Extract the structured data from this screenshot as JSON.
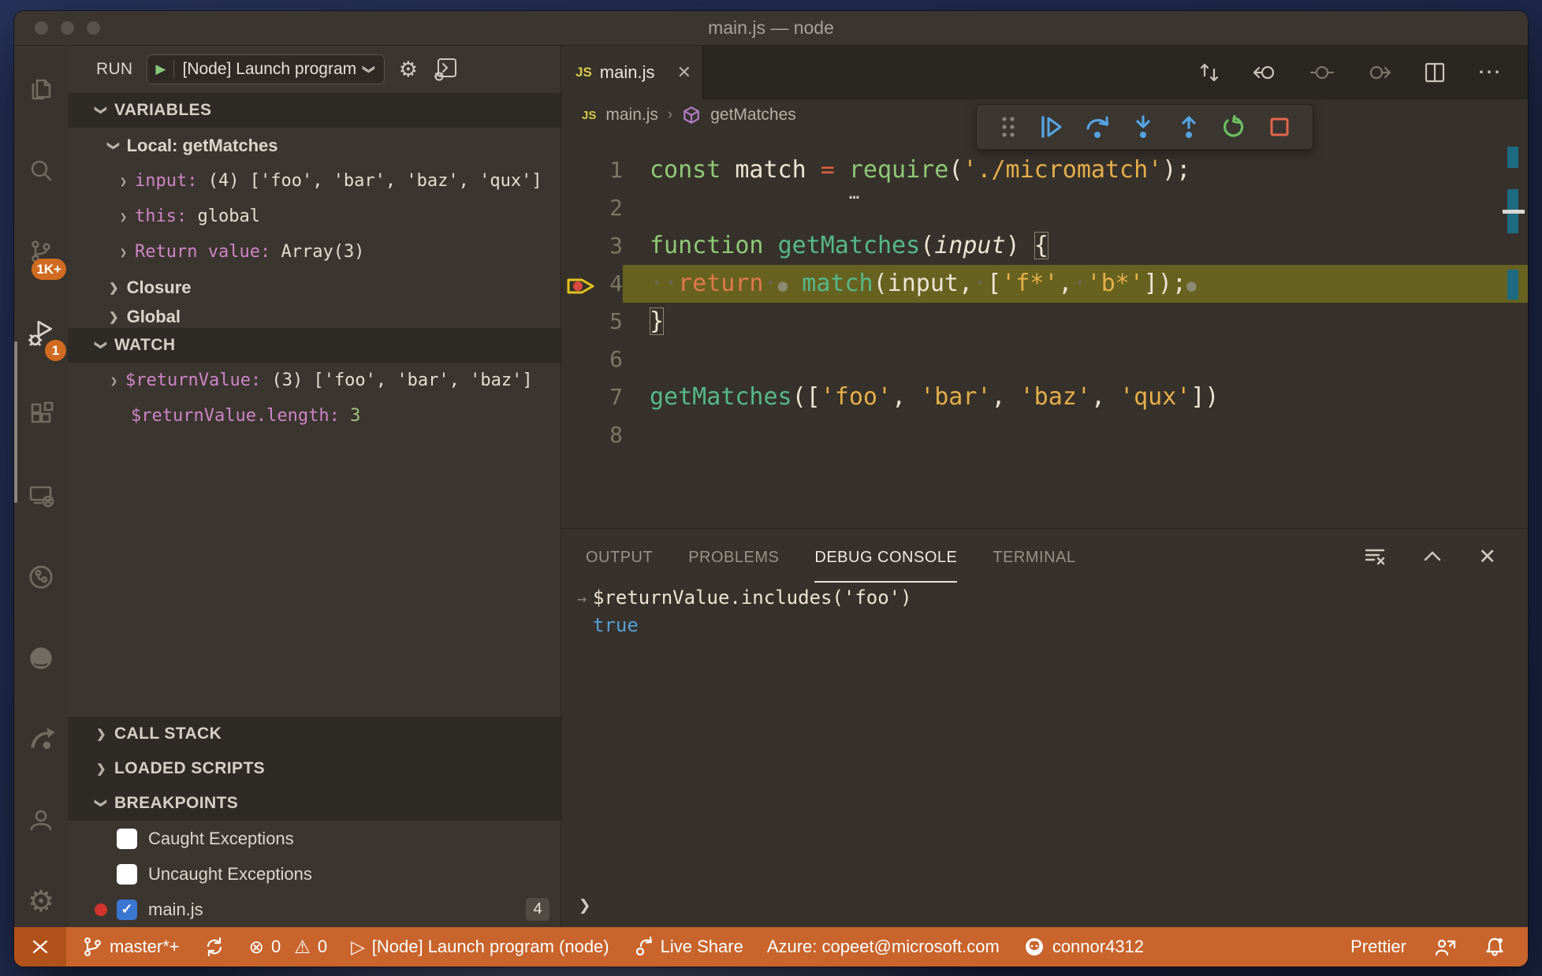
{
  "window": {
    "title": "main.js — node"
  },
  "icons": {
    "chevron": "❯",
    "gear": "⚙",
    "close": "✕",
    "more": "⋯",
    "error": "⊗",
    "warning": "⚠",
    "play_outline": "▷",
    "play_solid": "▶",
    "check": "✓",
    "breadcrumb_sep": "›",
    "console_arrow": "→",
    "prompt": "❯",
    "js_badge": "JS",
    "remote_glyph": "><"
  },
  "activity_bar": {
    "source_control_badge": "1K+",
    "debug_badge": "1"
  },
  "sidebar": {
    "run": {
      "label": "RUN",
      "config": "[Node] Launch program"
    },
    "variables": {
      "header": "VARIABLES",
      "scope": "Local: getMatches",
      "items": [
        {
          "name": "input: ",
          "value": "(4) ['foo', 'bar', 'baz', 'qux']"
        },
        {
          "name": "this: ",
          "value": "global"
        },
        {
          "name": "Return value: ",
          "value": "Array(3)"
        }
      ],
      "groups": [
        "Closure",
        "Global"
      ]
    },
    "watch": {
      "header": "WATCH",
      "item": {
        "name": "$returnValue: ",
        "value": "(3) ['foo', 'bar', 'baz']"
      },
      "plain_item": {
        "name": "$returnValue.length: ",
        "value": "3"
      }
    },
    "sections": [
      "CALL STACK",
      "LOADED SCRIPTS",
      "BREAKPOINTS"
    ],
    "breakpoints": [
      {
        "label": "Caught Exceptions",
        "checked": false
      },
      {
        "label": "Uncaught Exceptions",
        "checked": false
      },
      {
        "label": "main.js",
        "checked": true,
        "badge": "4"
      }
    ]
  },
  "editor": {
    "tab": {
      "label": "main.js"
    },
    "breadcrumb": {
      "file": "main.js",
      "symbol": "getMatches"
    },
    "lines": [
      {
        "num": "1",
        "tokens": [
          {
            "t": "const",
            "c": "kw"
          },
          {
            "t": " match ",
            "c": "txt"
          },
          {
            "t": "=",
            "c": "op"
          },
          {
            "t": " ",
            "c": "txt"
          },
          {
            "t": "require",
            "c": "kw"
          },
          {
            "t": "(",
            "c": "txt"
          },
          {
            "t": "'./micromatch'",
            "c": "str"
          },
          {
            "t": ");",
            "c": "txt"
          }
        ],
        "hint": {
          "text": "…",
          "col": 14
        }
      },
      {
        "num": "2",
        "tokens": []
      },
      {
        "num": "3",
        "tokens": [
          {
            "t": "function",
            "c": "kw"
          },
          {
            "t": " ",
            "c": "txt"
          },
          {
            "t": "getMatches",
            "c": "fn"
          },
          {
            "t": "(",
            "c": "txt"
          },
          {
            "t": "input",
            "c": "it"
          },
          {
            "t": ") ",
            "c": "txt"
          },
          {
            "t": "{",
            "c": "br"
          }
        ]
      },
      {
        "num": "4",
        "hl": true,
        "arrow": true,
        "tokens": [
          {
            "t": "··",
            "c": "ws"
          },
          {
            "t": "return",
            "c": "ret"
          },
          {
            "t": "·",
            "c": "ws"
          },
          {
            "t": "●",
            "c": "bp"
          },
          {
            "t": " ",
            "c": "txt"
          },
          {
            "t": "match",
            "c": "fn"
          },
          {
            "t": "(input,",
            "c": "txt"
          },
          {
            "t": "·",
            "c": "ws"
          },
          {
            "t": "[",
            "c": "txt"
          },
          {
            "t": "'f*'",
            "c": "str"
          },
          {
            "t": ",",
            "c": "txt"
          },
          {
            "t": "·",
            "c": "ws"
          },
          {
            "t": "'b*'",
            "c": "str"
          },
          {
            "t": "]);",
            "c": "txt"
          },
          {
            "t": "●",
            "c": "bp"
          }
        ]
      },
      {
        "num": "5",
        "tokens": [
          {
            "t": "}",
            "c": "br"
          }
        ]
      },
      {
        "num": "6",
        "tokens": []
      },
      {
        "num": "7",
        "tokens": [
          {
            "t": "getMatches",
            "c": "fn"
          },
          {
            "t": "([",
            "c": "txt"
          },
          {
            "t": "'foo'",
            "c": "str"
          },
          {
            "t": ", ",
            "c": "txt"
          },
          {
            "t": "'bar'",
            "c": "str"
          },
          {
            "t": ", ",
            "c": "txt"
          },
          {
            "t": "'baz'",
            "c": "str"
          },
          {
            "t": ", ",
            "c": "txt"
          },
          {
            "t": "'qux'",
            "c": "str"
          },
          {
            "t": "])",
            "c": "txt"
          }
        ]
      },
      {
        "num": "8",
        "tokens": []
      }
    ]
  },
  "panel": {
    "tabs": [
      {
        "label": "OUTPUT"
      },
      {
        "label": "PROBLEMS"
      },
      {
        "label": "DEBUG CONSOLE",
        "active": true
      },
      {
        "label": "TERMINAL"
      }
    ],
    "console": {
      "expression": "$returnValue.includes('foo')",
      "result": "true"
    }
  },
  "status_bar": {
    "branch": "master*+",
    "errors": "0",
    "warnings": "0",
    "run_status": "[Node] Launch program (node)",
    "live_share": "Live Share",
    "azure": "Azure: copeet@microsoft.com",
    "github_user": "connor4312",
    "prettier": "Prettier"
  },
  "colors": {
    "status-bar": "#c8642c",
    "status-cell": "#b2521b",
    "badge": "#d06b21",
    "hl-line": "#67621f",
    "kw": "#8fc978",
    "fn": "#55b98a",
    "str": "#e5ae4a",
    "op": "#e05f3a",
    "ret": "#e0784f",
    "txt": "#ece5d4",
    "ws": "#6e6854",
    "bp-dot": "#8e8971",
    "lnum": "#7c7666",
    "purple": "#cd85c6",
    "num-green": "#a3c183",
    "true-blue": "#549fd7",
    "check-blue": "#3a76d2",
    "bp-red": "#d0342c",
    "js-yellow": "#d6cc4a",
    "debug-blue": "#54a4e4",
    "restart-green": "#6cbf63",
    "stop-red": "#e2664b",
    "teal-mark": "#1d6b80"
  }
}
